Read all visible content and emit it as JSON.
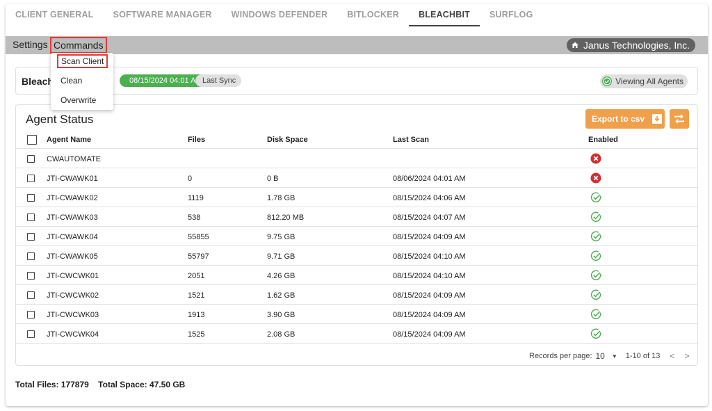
{
  "tabs": [
    {
      "label": "CLIENT GENERAL"
    },
    {
      "label": "SOFTWARE MANAGER"
    },
    {
      "label": "WINDOWS DEFENDER"
    },
    {
      "label": "BITLOCKER"
    },
    {
      "label": "BLEACHBIT",
      "active": true
    },
    {
      "label": "SURFLOG"
    }
  ],
  "toolbar": {
    "settings_label": "Settings",
    "commands_label": "Commands",
    "company": "Janus Technologies, Inc."
  },
  "commands_menu": {
    "items": [
      "Scan Client",
      "Clean",
      "Overwrite"
    ],
    "selected": "Scan Client"
  },
  "sync": {
    "title": "Bleachbit",
    "date": "08/15/2024 04:01 AM",
    "label": "Last Sync",
    "viewing": "Viewing All Agents"
  },
  "agent_status": {
    "title": "Agent Status",
    "export_label": "Export to csv",
    "columns": [
      "Agent Name",
      "Files",
      "Disk Space",
      "Last Scan",
      "Enabled"
    ],
    "rows": [
      {
        "name": "CWAUTOMATE",
        "files": "",
        "disk": "",
        "scan": "",
        "enabled": false
      },
      {
        "name": "JTI-CWAWK01",
        "files": "0",
        "disk": "0 B",
        "scan": "08/06/2024 04:01 AM",
        "enabled": false
      },
      {
        "name": "JTI-CWAWK02",
        "files": "1119",
        "disk": "1.78 GB",
        "scan": "08/15/2024 04:06 AM",
        "enabled": true
      },
      {
        "name": "JTI-CWAWK03",
        "files": "538",
        "disk": "812.20 MB",
        "scan": "08/15/2024 04:07 AM",
        "enabled": true
      },
      {
        "name": "JTI-CWAWK04",
        "files": "55855",
        "disk": "9.75 GB",
        "scan": "08/15/2024 04:09 AM",
        "enabled": true
      },
      {
        "name": "JTI-CWAWK05",
        "files": "55797",
        "disk": "9.71 GB",
        "scan": "08/15/2024 04:10 AM",
        "enabled": true
      },
      {
        "name": "JTI-CWCWK01",
        "files": "2051",
        "disk": "4.26 GB",
        "scan": "08/15/2024 04:10 AM",
        "enabled": true
      },
      {
        "name": "JTI-CWCWK02",
        "files": "1521",
        "disk": "1.62 GB",
        "scan": "08/15/2024 04:09 AM",
        "enabled": true
      },
      {
        "name": "JTI-CWCWK03",
        "files": "1913",
        "disk": "3.90 GB",
        "scan": "08/15/2024 04:09 AM",
        "enabled": true
      },
      {
        "name": "JTI-CWCWK04",
        "files": "1525",
        "disk": "2.08 GB",
        "scan": "08/15/2024 04:09 AM",
        "enabled": true
      }
    ],
    "pager": {
      "label": "Records per page:",
      "per_page": "10",
      "range": "1-10 of 13",
      "prev": "<",
      "next": ">"
    }
  },
  "totals": {
    "files": "Total Files: 177879",
    "space": "Total Space: 47.50 GB"
  },
  "colors": {
    "accent_orange": "#f0a04b",
    "success_green": "#4caf50",
    "error_red": "#d32f2f",
    "highlight_red": "#e53935",
    "toolbar_gray": "#bdbdbd"
  }
}
